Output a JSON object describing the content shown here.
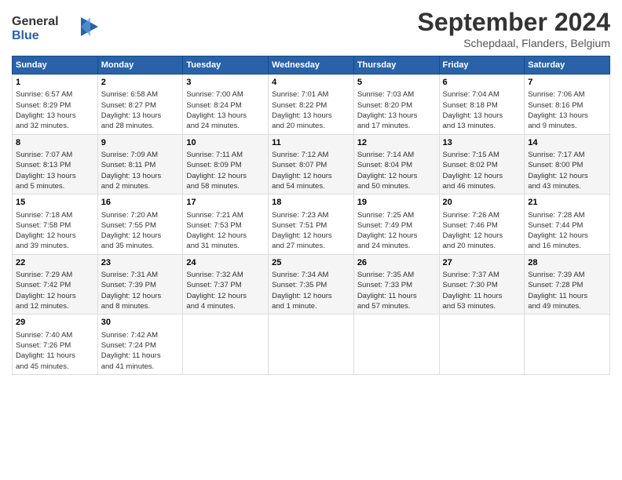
{
  "header": {
    "logo_line1": "General",
    "logo_line2": "Blue",
    "title": "September 2024",
    "subtitle": "Schepdaal, Flanders, Belgium"
  },
  "days_of_week": [
    "Sunday",
    "Monday",
    "Tuesday",
    "Wednesday",
    "Thursday",
    "Friday",
    "Saturday"
  ],
  "weeks": [
    [
      {
        "day": "1",
        "info": "Sunrise: 6:57 AM\nSunset: 8:29 PM\nDaylight: 13 hours\nand 32 minutes."
      },
      {
        "day": "2",
        "info": "Sunrise: 6:58 AM\nSunset: 8:27 PM\nDaylight: 13 hours\nand 28 minutes."
      },
      {
        "day": "3",
        "info": "Sunrise: 7:00 AM\nSunset: 8:24 PM\nDaylight: 13 hours\nand 24 minutes."
      },
      {
        "day": "4",
        "info": "Sunrise: 7:01 AM\nSunset: 8:22 PM\nDaylight: 13 hours\nand 20 minutes."
      },
      {
        "day": "5",
        "info": "Sunrise: 7:03 AM\nSunset: 8:20 PM\nDaylight: 13 hours\nand 17 minutes."
      },
      {
        "day": "6",
        "info": "Sunrise: 7:04 AM\nSunset: 8:18 PM\nDaylight: 13 hours\nand 13 minutes."
      },
      {
        "day": "7",
        "info": "Sunrise: 7:06 AM\nSunset: 8:16 PM\nDaylight: 13 hours\nand 9 minutes."
      }
    ],
    [
      {
        "day": "8",
        "info": "Sunrise: 7:07 AM\nSunset: 8:13 PM\nDaylight: 13 hours\nand 5 minutes."
      },
      {
        "day": "9",
        "info": "Sunrise: 7:09 AM\nSunset: 8:11 PM\nDaylight: 13 hours\nand 2 minutes."
      },
      {
        "day": "10",
        "info": "Sunrise: 7:11 AM\nSunset: 8:09 PM\nDaylight: 12 hours\nand 58 minutes."
      },
      {
        "day": "11",
        "info": "Sunrise: 7:12 AM\nSunset: 8:07 PM\nDaylight: 12 hours\nand 54 minutes."
      },
      {
        "day": "12",
        "info": "Sunrise: 7:14 AM\nSunset: 8:04 PM\nDaylight: 12 hours\nand 50 minutes."
      },
      {
        "day": "13",
        "info": "Sunrise: 7:15 AM\nSunset: 8:02 PM\nDaylight: 12 hours\nand 46 minutes."
      },
      {
        "day": "14",
        "info": "Sunrise: 7:17 AM\nSunset: 8:00 PM\nDaylight: 12 hours\nand 43 minutes."
      }
    ],
    [
      {
        "day": "15",
        "info": "Sunrise: 7:18 AM\nSunset: 7:58 PM\nDaylight: 12 hours\nand 39 minutes."
      },
      {
        "day": "16",
        "info": "Sunrise: 7:20 AM\nSunset: 7:55 PM\nDaylight: 12 hours\nand 35 minutes."
      },
      {
        "day": "17",
        "info": "Sunrise: 7:21 AM\nSunset: 7:53 PM\nDaylight: 12 hours\nand 31 minutes."
      },
      {
        "day": "18",
        "info": "Sunrise: 7:23 AM\nSunset: 7:51 PM\nDaylight: 12 hours\nand 27 minutes."
      },
      {
        "day": "19",
        "info": "Sunrise: 7:25 AM\nSunset: 7:49 PM\nDaylight: 12 hours\nand 24 minutes."
      },
      {
        "day": "20",
        "info": "Sunrise: 7:26 AM\nSunset: 7:46 PM\nDaylight: 12 hours\nand 20 minutes."
      },
      {
        "day": "21",
        "info": "Sunrise: 7:28 AM\nSunset: 7:44 PM\nDaylight: 12 hours\nand 16 minutes."
      }
    ],
    [
      {
        "day": "22",
        "info": "Sunrise: 7:29 AM\nSunset: 7:42 PM\nDaylight: 12 hours\nand 12 minutes."
      },
      {
        "day": "23",
        "info": "Sunrise: 7:31 AM\nSunset: 7:39 PM\nDaylight: 12 hours\nand 8 minutes."
      },
      {
        "day": "24",
        "info": "Sunrise: 7:32 AM\nSunset: 7:37 PM\nDaylight: 12 hours\nand 4 minutes."
      },
      {
        "day": "25",
        "info": "Sunrise: 7:34 AM\nSunset: 7:35 PM\nDaylight: 12 hours\nand 1 minute."
      },
      {
        "day": "26",
        "info": "Sunrise: 7:35 AM\nSunset: 7:33 PM\nDaylight: 11 hours\nand 57 minutes."
      },
      {
        "day": "27",
        "info": "Sunrise: 7:37 AM\nSunset: 7:30 PM\nDaylight: 11 hours\nand 53 minutes."
      },
      {
        "day": "28",
        "info": "Sunrise: 7:39 AM\nSunset: 7:28 PM\nDaylight: 11 hours\nand 49 minutes."
      }
    ],
    [
      {
        "day": "29",
        "info": "Sunrise: 7:40 AM\nSunset: 7:26 PM\nDaylight: 11 hours\nand 45 minutes."
      },
      {
        "day": "30",
        "info": "Sunrise: 7:42 AM\nSunset: 7:24 PM\nDaylight: 11 hours\nand 41 minutes."
      },
      {
        "day": "",
        "info": ""
      },
      {
        "day": "",
        "info": ""
      },
      {
        "day": "",
        "info": ""
      },
      {
        "day": "",
        "info": ""
      },
      {
        "day": "",
        "info": ""
      }
    ]
  ]
}
